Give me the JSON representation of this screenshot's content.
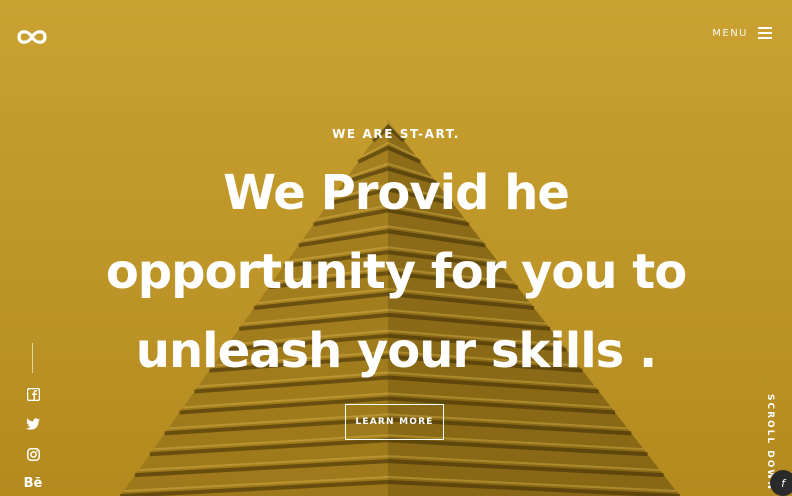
{
  "brand": {
    "logo_icon": "infinity-logo-icon",
    "accent_color": "#c49a26"
  },
  "nav": {
    "menu_label": "MENU",
    "menu_icon": "hamburger-icon"
  },
  "hero": {
    "kicker": "WE ARE ST-ART.",
    "headline_lines": [
      "We Provid he",
      "opportunity for you to",
      "unleash your skills ."
    ],
    "cta_label": "LEARN MORE",
    "scroll_label": "SCROLL DOWN"
  },
  "social": [
    {
      "icon": "facebook-icon",
      "label": "f"
    },
    {
      "icon": "twitter-icon",
      "label": "t"
    },
    {
      "icon": "instagram-icon",
      "label": "ig"
    },
    {
      "icon": "behance-icon",
      "label": "Bē"
    }
  ],
  "corner_badge": {
    "icon": "chat-icon"
  }
}
